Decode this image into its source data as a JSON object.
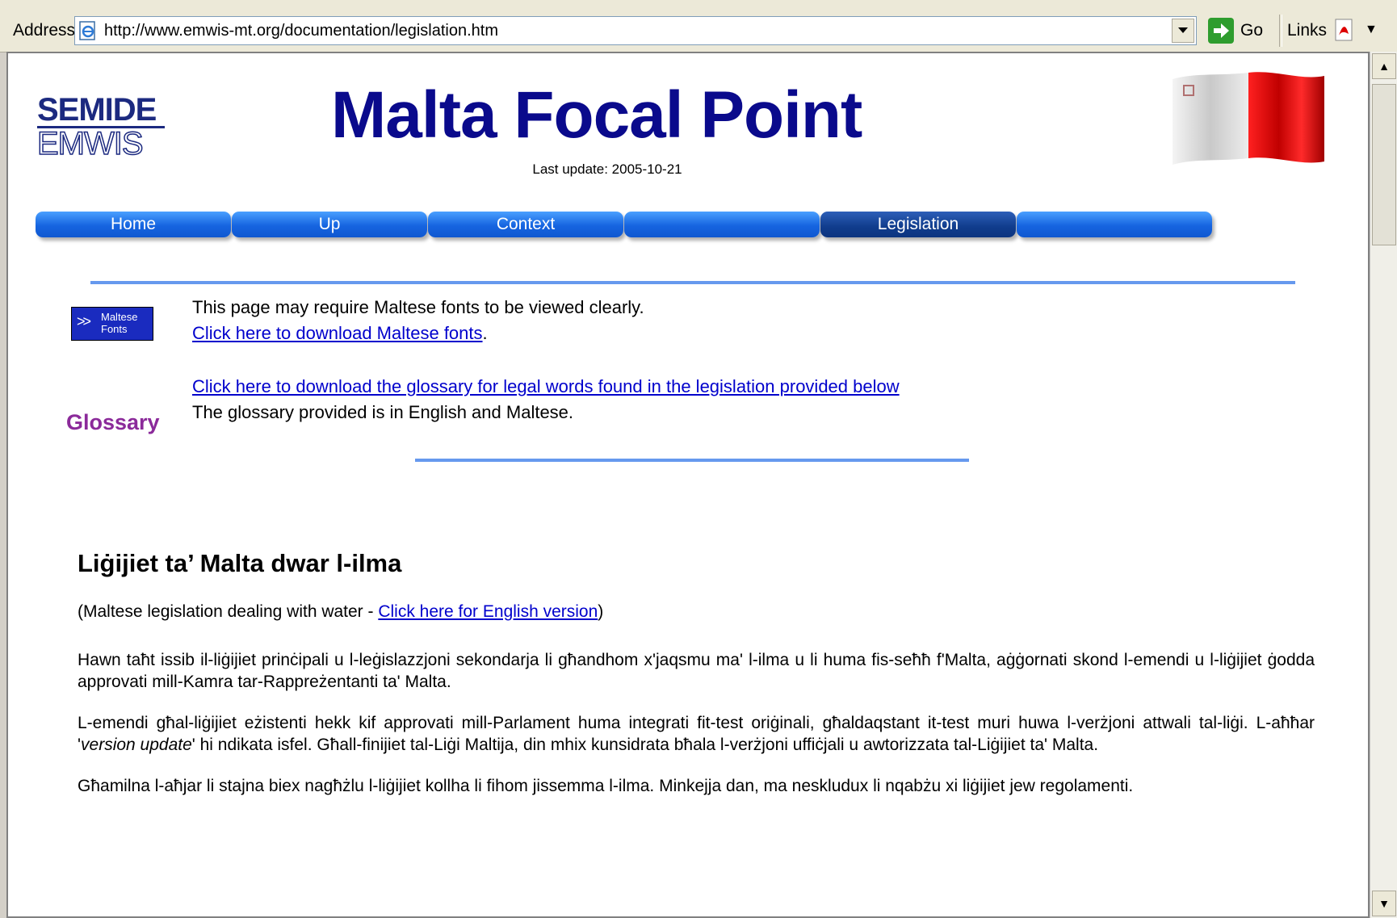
{
  "browser": {
    "address_label": "Address",
    "url": "http://www.emwis-mt.org/documentation/legislation.htm",
    "go_label": "Go",
    "links_label": "Links"
  },
  "header": {
    "logo_top": "SEMIDE",
    "logo_bottom": "EMWIS",
    "title": "Malta Focal Point",
    "last_update": "Last update: 2005-10-21"
  },
  "nav": {
    "items": [
      {
        "label": "Home"
      },
      {
        "label": "Up"
      },
      {
        "label": "Context"
      },
      {
        "label": ""
      },
      {
        "label": "Legislation"
      },
      {
        "label": ""
      }
    ]
  },
  "fonts_notice": {
    "badge_line1": "Maltese",
    "badge_line2": "Fonts",
    "text": "This page may require Maltese fonts to be viewed clearly.",
    "link": "Click here to download Maltese fonts",
    "suffix": "."
  },
  "glossary": {
    "label": "Glossary",
    "link": "Click here to download the glossary for legal words found in the legislation provided below",
    "note": "The glossary provided is in English and Maltese."
  },
  "content": {
    "heading": "Liġijiet ta’ Malta dwar l-ilma",
    "subtitle_prefix": "(Maltese legislation dealing with water - ",
    "subtitle_link": "Click here for English version",
    "subtitle_suffix": ")",
    "para1": "Hawn taħt issib il-liġijiet prinċipali u l-leġislazzjoni sekondarja li għandhom x'jaqsmu ma' l-ilma u li huma fis-seħħ f'Malta, aġġornati skond l-emendi u l-liġijiet ġodda approvati mill-Kamra tar-Rappreżentanti ta' Malta.",
    "para2_a": "L-emendi għal-liġijiet eżistenti hekk kif approvati mill-Parlament huma integrati fit-test oriġinali, għaldaqstant it-test muri huwa l-verżjoni attwali tal-liġi. L-aħħar '",
    "para2_em": "version update",
    "para2_b": "' hi ndikata isfel. Għall-finijiet tal-Liġi Maltija, din mhix kunsidrata bħala l-verżjoni uffiċjali u awtorizzata tal-Liġijiet ta' Malta.",
    "para3": "Għamilna l-aħjar li stajna biex nagħżlu l-liġijiet kollha li fihom jissemma l-ilma. Minkejja dan, ma neskludux li nqabżu xi liġijiet jew regolamenti."
  },
  "colors": {
    "title": "#0a0a8c",
    "nav": "#1664e0",
    "nav_active": "#103c8c",
    "rule": "#6699ee",
    "glossary": "#8b2a9a",
    "link": "#0000cc"
  },
  "icons": [
    "ie-page-icon",
    "dropdown-arrow-icon",
    "go-arrow-icon",
    "pdf-icon",
    "malta-flag-icon",
    "scroll-up-icon",
    "scroll-down-icon"
  ]
}
